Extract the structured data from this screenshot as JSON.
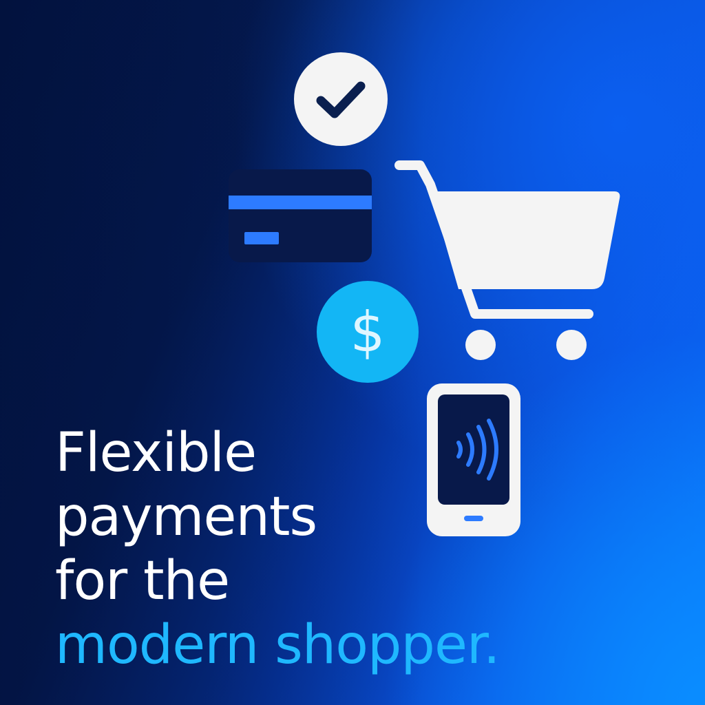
{
  "headline": {
    "line1": "Flexible",
    "line2": "payments",
    "line3": "for the",
    "line4": "modern shopper."
  },
  "dollar_symbol": "$",
  "icons": [
    "check-icon",
    "credit-card-icon",
    "dollar-coin-icon",
    "shopping-cart-icon",
    "contactless-phone-icon"
  ],
  "colors": {
    "background_dark": "#03174a",
    "background_bright": "#0b74ff",
    "headline_white": "#ffffff",
    "headline_accent": "#1fb8ff",
    "icon_light": "#f4f4f4",
    "card_dark": "#08194a",
    "card_stripe": "#2d7bff",
    "coin_cyan": "#13b6f5",
    "checkmark": "#0a1f4f"
  }
}
